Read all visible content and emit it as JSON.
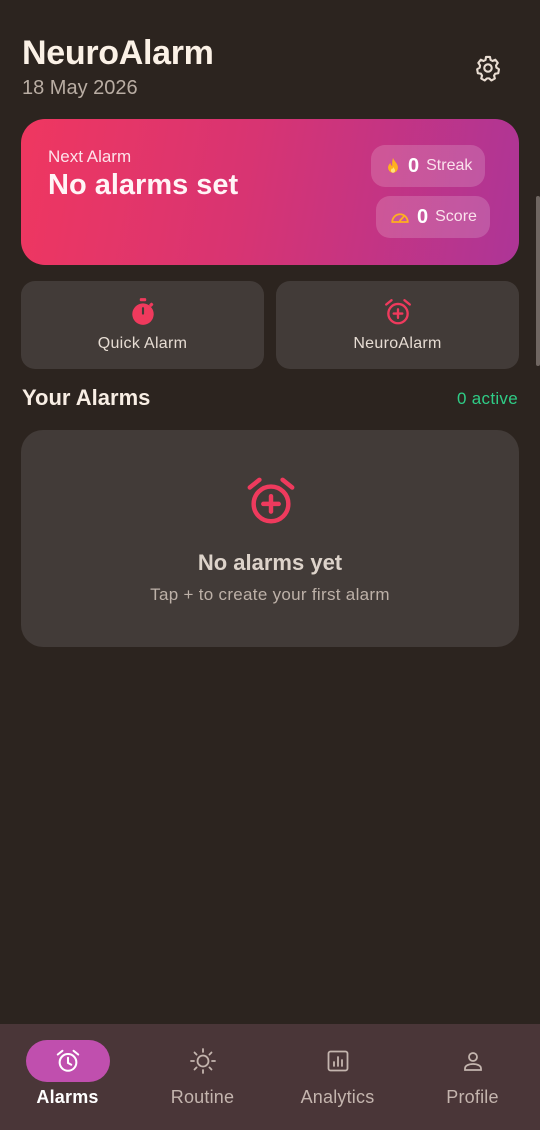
{
  "header": {
    "title": "NeuroAlarm",
    "date": "18 May 2026",
    "settings_icon": "gear-icon"
  },
  "next_alarm": {
    "label": "Next Alarm",
    "value": "No alarms set",
    "streak": {
      "icon": "flame-icon",
      "value": "0",
      "label": "Streak"
    },
    "score": {
      "icon": "speedometer-icon",
      "value": "0",
      "label": "Score"
    }
  },
  "quick_actions": [
    {
      "icon": "stopwatch-icon",
      "label": "Quick Alarm"
    },
    {
      "icon": "alarm-add-icon",
      "label": "NeuroAlarm"
    }
  ],
  "alarms_section": {
    "title": "Your Alarms",
    "active_count": "0 active"
  },
  "empty_state": {
    "icon": "alarm-add-icon",
    "title": "No alarms yet",
    "subtitle": "Tap + to create your first alarm"
  },
  "bottom_nav": [
    {
      "icon": "alarm-clock-icon",
      "label": "Alarms",
      "active": true
    },
    {
      "icon": "sun-icon",
      "label": "Routine",
      "active": false
    },
    {
      "icon": "bar-chart-icon",
      "label": "Analytics",
      "active": false
    },
    {
      "icon": "person-icon",
      "label": "Profile",
      "active": false
    }
  ],
  "colors": {
    "background": "#2c241f",
    "card": "#423b38",
    "accent_red": "#ef3a5d",
    "gradient_start": "#ef3760",
    "gradient_end": "#ad3597",
    "active_green": "#2fcc86",
    "nav_background": "#4a3638",
    "nav_active_pill": "#c04fae"
  }
}
